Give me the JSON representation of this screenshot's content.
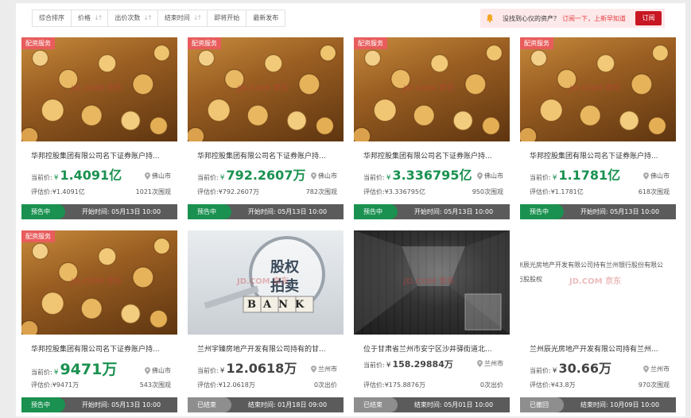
{
  "sort": {
    "items": [
      {
        "label": "综合排序",
        "arrow": false
      },
      {
        "label": "价格",
        "arrow": true
      },
      {
        "label": "出价次数",
        "arrow": true
      },
      {
        "label": "结束时间",
        "arrow": true
      },
      {
        "label": "即将开始",
        "arrow": false
      },
      {
        "label": "最新发布",
        "arrow": false
      }
    ]
  },
  "subscribe": {
    "text": "没找到心仪的资产？",
    "link": "订阅一下，上新早知道",
    "button": "订阅"
  },
  "labels": {
    "price_prefix": "当前价:",
    "currency": "¥",
    "watermark": "JD.COM 京东"
  },
  "cards": [
    {
      "badge": "配资服务",
      "title": "华邦控股集团有限公司名下证券账户持...",
      "price": "1.4091亿",
      "city": "佛山市",
      "eval": "评估价:¥1.4091亿",
      "count": "1021次围观",
      "status": "预告中",
      "time": "开始时间: 05月13日 10:00"
    },
    {
      "badge": "配资服务",
      "title": "华邦控股集团有限公司名下证券账户持...",
      "price": "792.2607万",
      "city": "佛山市",
      "eval": "评估价:¥792.2607万",
      "count": "782次围观",
      "status": "预告中",
      "time": "开始时间: 05月13日 10:00"
    },
    {
      "badge": "配资服务",
      "title": "华邦控股集团有限公司名下证券账户持...",
      "price": "3.336795亿",
      "city": "佛山市",
      "eval": "评估价:¥3.336795亿",
      "count": "950次围观",
      "status": "预告中",
      "time": "开始时间: 05月13日 10:00"
    },
    {
      "badge": "配资服务",
      "title": "华邦控股集团有限公司名下证券账户持...",
      "price": "1.1781亿",
      "city": "佛山市",
      "eval": "评估价:¥1.1781亿",
      "count": "618次围观",
      "status": "预告中",
      "time": "开始时间: 05月13日 10:00"
    },
    {
      "badge": "配资服务",
      "title": "华邦控股集团有限公司名下证券账户持...",
      "price": "9471万",
      "city": "佛山市",
      "eval": "评估价:¥9471万",
      "count": "543次围观",
      "status": "预告中",
      "time": "开始时间: 05月13日 10:00"
    },
    {
      "badge": "",
      "title": "兰州宇臻房地产开发有限公司持有的甘...",
      "price": "12.0618万",
      "city": "兰州市",
      "eval": "评估价:¥12.0618万",
      "count": "0次出价",
      "status": "已结束",
      "time": "结束时间: 01月18日 09:00",
      "image_text_1": "股权",
      "image_text_2": "拍卖",
      "image_text_3": "BANK"
    },
    {
      "badge": "",
      "title": "位于甘肃省兰州市安宁区沙井驿街道北...",
      "price": "158.29884万",
      "city": "兰州市",
      "eval": "评估价:¥175.8876万",
      "count": "0次出价",
      "status": "已结束",
      "time": "结束时间: 05月01日 10:00"
    },
    {
      "badge": "",
      "title": "兰州辰光房地产开发有限公司持有兰州...",
      "price": "30.66万",
      "city": "兰州市",
      "eval": "评估价:¥43.8万",
      "count": "970次围观",
      "status": "已撤回",
      "time": "结束时间: 10月09日 10:00",
      "image_text_1": "州辰光房地产开发有限公司持有兰州银行股份有限公",
      "image_text_2": "万股股权"
    }
  ],
  "colors": {
    "accent_red": "#c81623",
    "price_green": "#1a9150",
    "badge_red": "#e85c5c"
  }
}
